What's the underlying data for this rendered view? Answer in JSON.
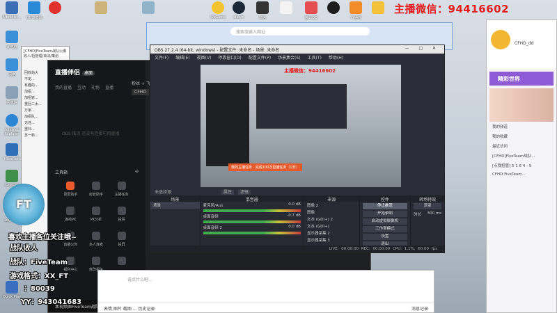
{
  "desktop": {
    "icons": [
      {
        "label": "Administ...",
        "color": "#3b6fb5"
      },
      {
        "label": "QQ浏览器",
        "color": "#2a8ad6"
      },
      {
        "label": "此电脑",
        "color": "#3a8fd8"
      },
      {
        "label": "网络",
        "color": "#3a8fd8"
      },
      {
        "label": "回收站",
        "color": "#8aa0b6"
      },
      {
        "label": "Internet Explorer",
        "color": "#2a86d4"
      },
      {
        "label": "Microsoft",
        "color": "#2f6fb8"
      },
      {
        "label": "GeeGee",
        "color": "#3f8f4a"
      },
      {
        "label": "Logitech",
        "color": "#1a8ccf"
      },
      {
        "label": "Quick Play",
        "color": "#3a6fc0"
      }
    ],
    "top_icons": [
      "WeGame",
      "steam",
      "微信",
      "腾讯QQ",
      "YY语音"
    ],
    "headline_label": "主播微信：",
    "headline_value": "94416602"
  },
  "fm_window": {
    "title": "[CFHD]FiveTeam战队火爆收人/招管理/商法/策划",
    "rows": [
      "回收站大",
      "不定...",
      "有趣的...",
      "加招...",
      "加招管...",
      "重回二太...",
      "万家...",
      "加招队...",
      "无佳...",
      "重归...",
      "苏一新..."
    ]
  },
  "live": {
    "brand": "直播伴侣",
    "version": "桌面",
    "tabs": [
      "我的直播",
      "互动",
      "礼物",
      "直播"
    ],
    "empty_text": "OBS 推流 还没有连接可用直播",
    "tools_label": "工具箱",
    "tools": [
      "录屏助手",
      "房管助手",
      "主播任务",
      "连线PK",
      "PK分析",
      "投票",
      "直播公告",
      "多人连麦",
      "投屏",
      "福利中心",
      "修改相关",
      "",
      "",
      "",
      ""
    ],
    "right_labels": [
      "粉丝 + 飞",
      "CFHD"
    ],
    "bottom_text": "本视频由FiveTeam战队团长录制及剪辑"
  },
  "chat": {
    "placeholder": "说点什么吧...",
    "send": "发送",
    "toolbar": "表情  图片  截图  ...  历史记录",
    "right_info": "消息记录"
  },
  "browser": {
    "url_placeholder": "搜索或输入网址"
  },
  "obs": {
    "title": "OBS 27.2.4 (64-bit, windows) - 配置文件: 未命名 - 场景: 未命名",
    "window_controls": "— □ ✕",
    "menu": [
      "文件(F)",
      "编辑(E)",
      "视图(V)",
      "停靠窗口(D)",
      "配置文件(P)",
      "场景集合(S)",
      "工具(T)",
      "帮助(H)"
    ],
    "preview_headline": "主播微信：94416602",
    "preview_badge": "我的主播任务 · 完成100次直播任务（1天）",
    "mode_label": "未选择源",
    "mode_buttons": [
      "属性",
      "滤镜"
    ],
    "scenes": {
      "header": "场景",
      "items": [
        "场景"
      ]
    },
    "sources": {
      "header": "来源",
      "items": [
        "图像 2",
        "图像",
        "文本 (GDI+) 2",
        "文本 (GDI+)",
        "显示器采集 2",
        "显示器采集 3"
      ]
    },
    "mixer": {
      "header": "混音器",
      "items": [
        {
          "name": "麦克风/Aux",
          "value": "0.0 dB"
        },
        {
          "name": "桌面音频",
          "value": "-0.7 dB"
        },
        {
          "name": "桌面音频 2",
          "value": "0.0 dB"
        }
      ]
    },
    "transitions": {
      "header": "转场特效",
      "type": "渐变",
      "duration_label": "时长",
      "duration": "300 ms"
    },
    "controls": {
      "header": "控件",
      "buttons": [
        "停止推流",
        "开始录制",
        "启动虚拟摄像机",
        "工作室模式",
        "设置",
        "退出"
      ]
    },
    "status": "LIVE: 00:00:00  REC: 00:00:00  CPU: 1.1%, 60.00 fps"
  },
  "yy": {
    "name": "CFHD_dd",
    "ad": "精彩世界",
    "items": [
      "我的频道",
      "我的收藏",
      "最近访问",
      "[CFHD]FiveTeam战队...",
      "[点我招管]  5 1 6 4 - 9",
      "CFHD  FiveTeam..."
    ]
  },
  "overlay": {
    "line1": "喜欢主播各位关注哦~",
    "line2": "战队收人",
    "line3": "战队：FiveTeam",
    "line4": "游戏格式：XX_FT",
    "line5": "：80039",
    "line6": "YY：943041683"
  },
  "logo_text": "FT"
}
